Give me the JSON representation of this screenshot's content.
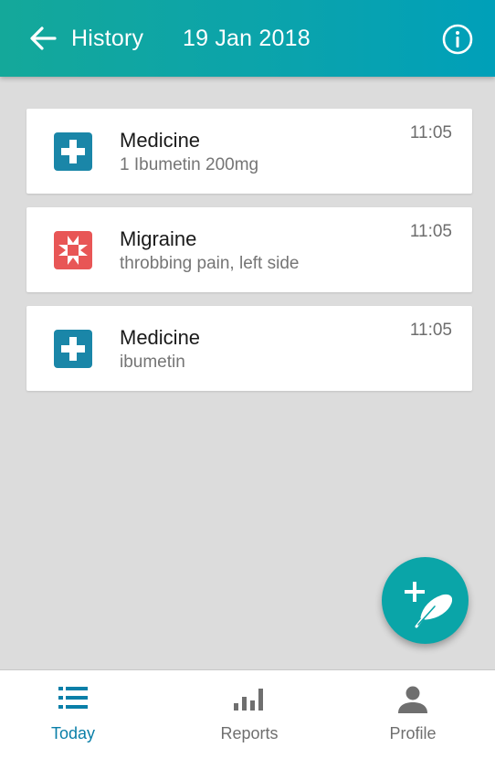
{
  "header": {
    "title": "History",
    "date": "19 Jan 2018"
  },
  "entries": [
    {
      "title": "Medicine",
      "subtitle": "1 Ibumetin 200mg",
      "time": "11:05",
      "icon": "medicine-cross-icon",
      "color": "#1a86a8"
    },
    {
      "title": "Migraine",
      "subtitle": "throbbing pain, left side",
      "time": "11:05",
      "icon": "migraine-burst-icon",
      "color": "#e85656"
    },
    {
      "title": "Medicine",
      "subtitle": "ibumetin",
      "time": "11:05",
      "icon": "medicine-cross-icon",
      "color": "#1a86a8"
    }
  ],
  "fab": {
    "icon": "add-entry-feather-icon"
  },
  "nav": [
    {
      "label": "Today",
      "icon": "list-icon",
      "active": true
    },
    {
      "label": "Reports",
      "icon": "bar-chart-icon",
      "active": false
    },
    {
      "label": "Profile",
      "icon": "person-icon",
      "active": false
    }
  ],
  "colors": {
    "accent": "#0aa5a8",
    "nav_active": "#0a7fa8",
    "medicine": "#1a86a8",
    "migraine": "#e85656"
  }
}
